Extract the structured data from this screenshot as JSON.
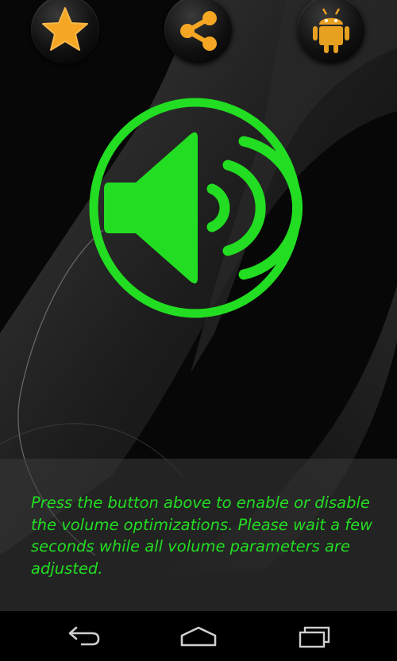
{
  "top_buttons": {
    "rate": "star-icon",
    "share": "share-icon",
    "more_apps": "android-icon"
  },
  "main": {
    "toggle_icon": "speaker-volume-icon",
    "toggle_color": "#22dd22",
    "info_text": "Press the button above to enable or disable the volume optimizations. Please wait a few seconds while all volume parameters are adjusted."
  },
  "nav_bar": {
    "back": "back-icon",
    "home": "home-icon",
    "recents": "recents-icon"
  },
  "colors": {
    "accent_green": "#22dd22",
    "icon_orange": "#f5a623",
    "background": "#050505"
  }
}
